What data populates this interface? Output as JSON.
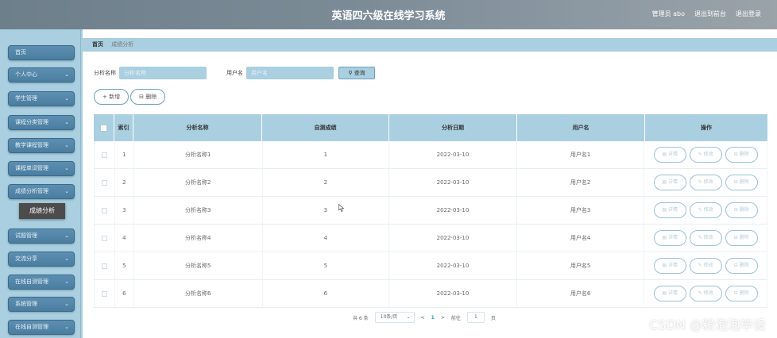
{
  "header": {
    "title": "英语四六级在线学习系统",
    "admin_label": "管理员 abo",
    "back_link": "退出到前台",
    "logout_link": "退出登录"
  },
  "sidebar": {
    "items": [
      {
        "label": "首页"
      },
      {
        "label": "个人中心"
      },
      {
        "label": "学生管理"
      },
      {
        "label": "课程分类管理"
      },
      {
        "label": "教学课程管理"
      },
      {
        "label": "课程单词管理"
      },
      {
        "label": "成绩分析管理"
      },
      {
        "label": "试题管理"
      },
      {
        "label": "交流分享"
      },
      {
        "label": "在线自测管理"
      },
      {
        "label": "系统管理"
      },
      {
        "label": "在线自测管理"
      }
    ],
    "submenu_active": "成绩分析"
  },
  "breadcrumb": {
    "home": "首页",
    "current": "成绩分析"
  },
  "search": {
    "name_label": "分析名称",
    "name_placeholder": "分析名称",
    "user_label": "用户名",
    "user_placeholder": "用户名",
    "query_button": "查询"
  },
  "actions": {
    "add": "新增",
    "delete": "删除"
  },
  "table": {
    "headers": {
      "index": "索引",
      "name": "分析名称",
      "score": "自测成绩",
      "date": "分析日期",
      "user": "用户名",
      "ops": "操作"
    },
    "op_labels": {
      "detail": "详情",
      "edit": "修改",
      "delete": "删除"
    },
    "rows": [
      {
        "index": "1",
        "name": "分析名称1",
        "score": "1",
        "date": "2022-03-10",
        "user": "用户名1"
      },
      {
        "index": "2",
        "name": "分析名称2",
        "score": "2",
        "date": "2022-03-10",
        "user": "用户名2"
      },
      {
        "index": "3",
        "name": "分析名称3",
        "score": "3",
        "date": "2022-03-10",
        "user": "用户名3"
      },
      {
        "index": "4",
        "name": "分析名称4",
        "score": "4",
        "date": "2022-03-10",
        "user": "用户名4"
      },
      {
        "index": "5",
        "name": "分析名称5",
        "score": "5",
        "date": "2022-03-10",
        "user": "用户名5"
      },
      {
        "index": "6",
        "name": "分析名称6",
        "score": "6",
        "date": "2022-03-10",
        "user": "用户名6"
      }
    ]
  },
  "pager": {
    "total": "共 6 条",
    "page_size": "10条/页",
    "prev": "<",
    "current_page": "1",
    "next": ">",
    "goto_label": "前往",
    "goto_value": "1",
    "page_unit": "页"
  },
  "watermark": "CSDN @粉泡泡毕设"
}
